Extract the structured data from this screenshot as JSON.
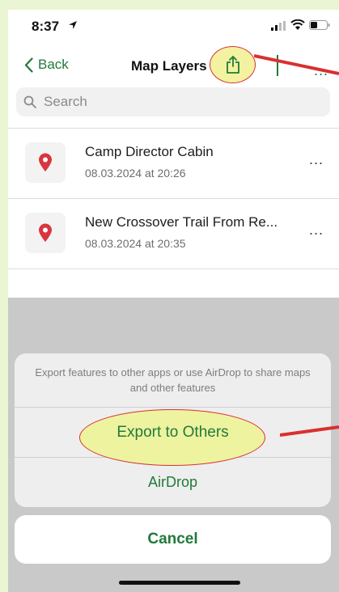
{
  "status_bar": {
    "time": "8:37"
  },
  "nav": {
    "back_label": "Back",
    "title": "Map Layers"
  },
  "search": {
    "placeholder": "Search"
  },
  "layers": [
    {
      "title": "Camp Director Cabin",
      "date": "08.03.2024 at 20:26"
    },
    {
      "title": "New Crossover Trail From Re...",
      "date": "08.03.2024 at 20:35"
    }
  ],
  "action_sheet": {
    "message": "Export features to other apps or use AirDrop to share maps and other features",
    "export_label": "Export to Others",
    "airdrop_label": "AirDrop",
    "cancel_label": "Cancel"
  },
  "more_glyph": "...",
  "colors": {
    "accent": "#217a3a",
    "pin": "#d9363e",
    "annotation": "#d93030",
    "highlight": "#eef3a0"
  },
  "icons": [
    "location-arrow-icon",
    "signal-icon",
    "wifi-icon",
    "battery-icon",
    "chevron-left-icon",
    "share-icon",
    "search-icon",
    "map-pin-icon",
    "more-icon"
  ]
}
